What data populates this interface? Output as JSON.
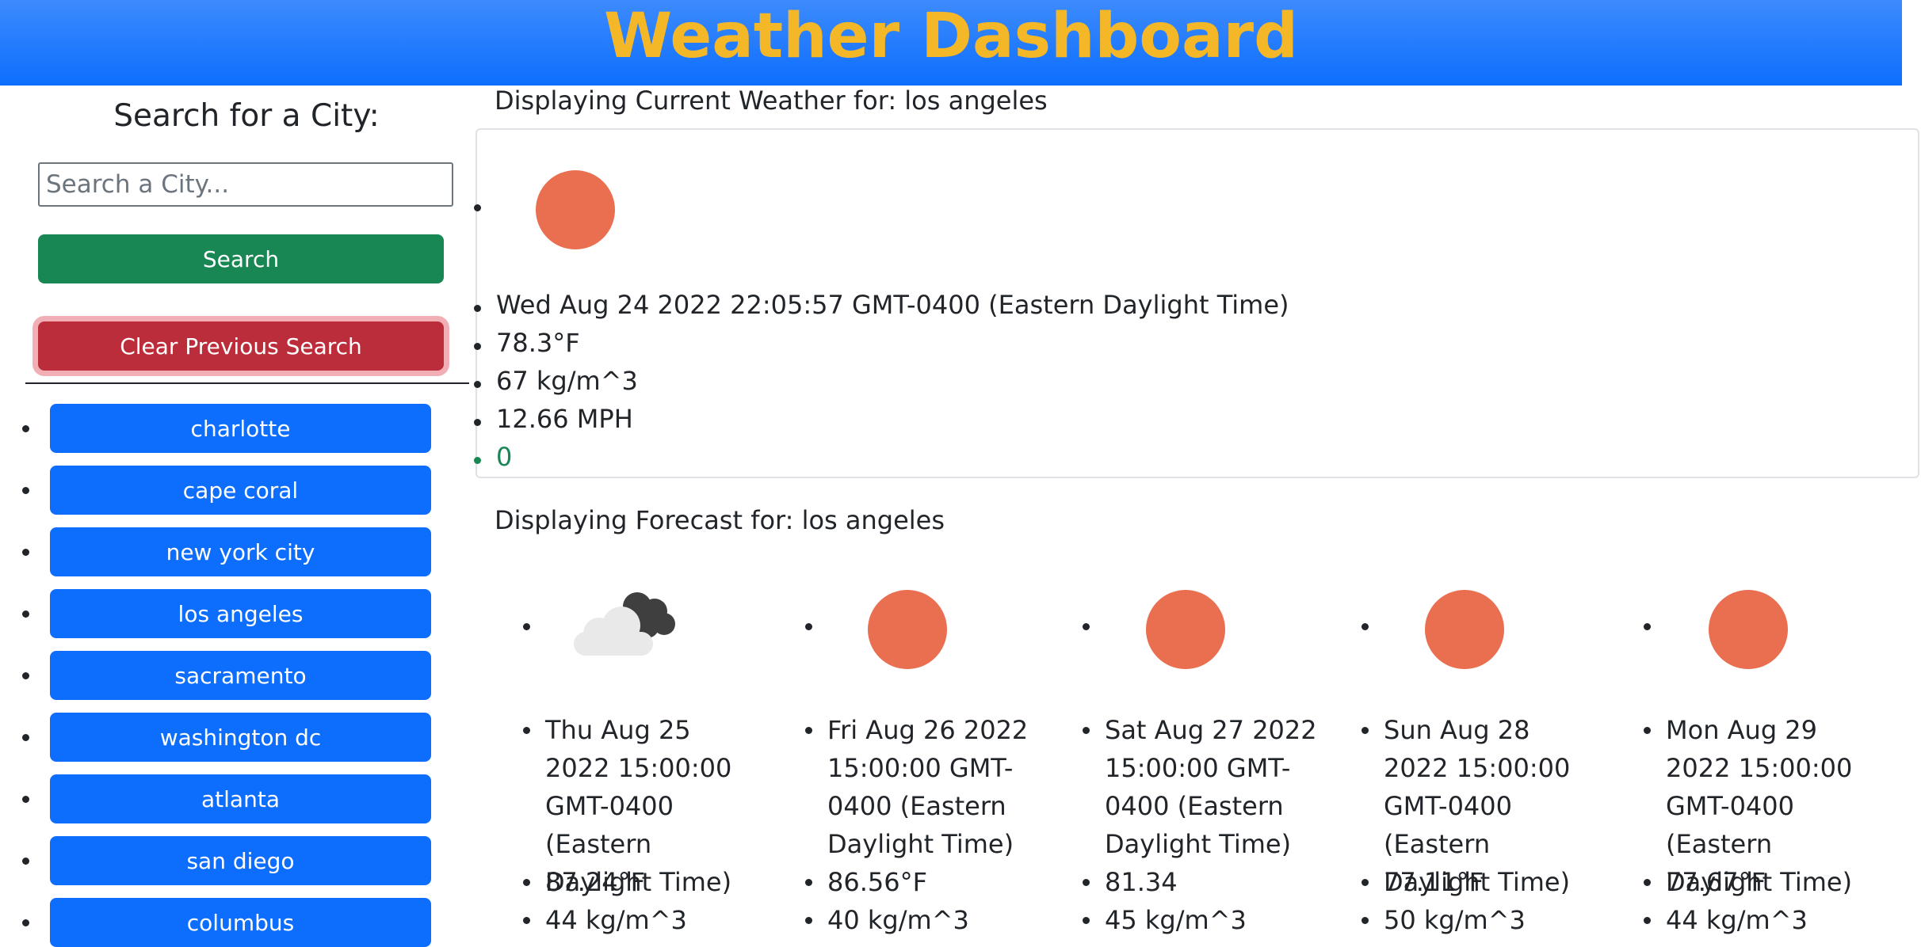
{
  "header": {
    "title": "Weather Dashboard"
  },
  "search": {
    "title": "Search for a City:",
    "placeholder": "Search a City...",
    "search_label": "Search",
    "clear_label": "Clear Previous Search"
  },
  "history": [
    "charlotte",
    "cape coral",
    "new york city",
    "los angeles",
    "sacramento",
    "washington dc",
    "atlanta",
    "san diego",
    "columbus"
  ],
  "current": {
    "heading": "Displaying Current Weather for: los angeles",
    "icon": "sun-icon",
    "date": "Wed Aug 24 2022 22:05:57 GMT-0400 (Eastern Daylight Time)",
    "temp": "78.3°F",
    "humidity": "67 kg/m^3",
    "wind": "12.66 MPH",
    "uv": "0"
  },
  "forecast": {
    "heading": "Displaying Forecast for: los angeles",
    "days": [
      {
        "icon": "cloud-icon",
        "date": "Thu Aug 25 2022 15:00:00 GMT-0400 (Eastern Daylight Time)",
        "temp": "87.24°F",
        "humidity": "44 kg/m^3"
      },
      {
        "icon": "sun-icon",
        "date": "Fri Aug 26 2022 15:00:00 GMT-0400 (Eastern Daylight Time)",
        "temp": "86.56°F",
        "humidity": "40 kg/m^3"
      },
      {
        "icon": "sun-icon",
        "date": "Sat Aug 27 2022 15:00:00 GMT-0400 (Eastern Daylight Time)",
        "temp": "81.34",
        "humidity": "45 kg/m^3"
      },
      {
        "icon": "sun-icon",
        "date": "Sun Aug 28 2022 15:00:00 GMT-0400 (Eastern Daylight Time)",
        "temp": "77.11°F",
        "humidity": "50 kg/m^3"
      },
      {
        "icon": "sun-icon",
        "date": "Mon Aug 29 2022 15:00:00 GMT-0400 (Eastern Daylight Time)",
        "temp": "77.67°F",
        "humidity": "44 kg/m^3"
      }
    ]
  },
  "colors": {
    "header_top": "#3d8bfd",
    "header_bottom": "#0d6efd",
    "title": "#f4b728",
    "search_button": "#198754",
    "clear_button": "#bb2d3b",
    "city_button": "#0d6efd",
    "sun": "#ea6e50",
    "uv_text": "#198754"
  }
}
